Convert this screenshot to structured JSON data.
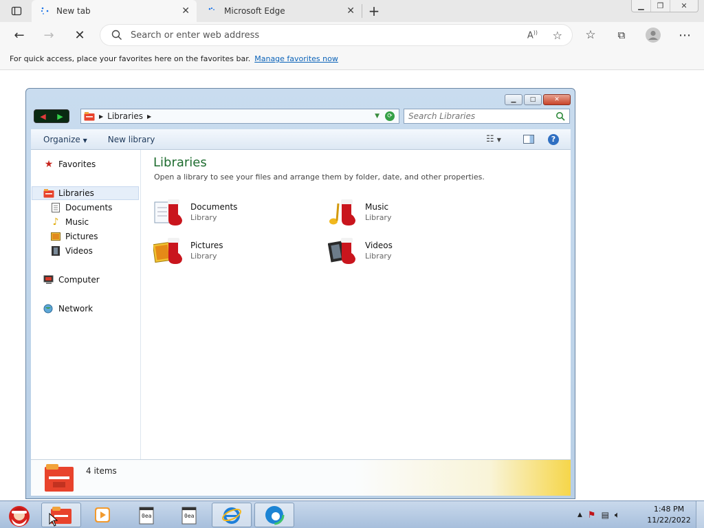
{
  "browser": {
    "tabs": [
      {
        "label": "New tab",
        "active": true
      },
      {
        "label": "Microsoft Edge",
        "active": false
      }
    ],
    "new_tab_icon": "plus-icon",
    "address_placeholder": "Search or enter web address",
    "favbar": {
      "message": "For quick access, place your favorites here on the favorites bar.",
      "link": "Manage favorites now"
    },
    "accent_link": "#0a62b8"
  },
  "explorer": {
    "breadcrumb": "Libraries",
    "search_placeholder": "Search Libraries",
    "commands": {
      "organize": "Organize",
      "new_library": "New library"
    },
    "nav": {
      "favorites": "Favorites",
      "libraries": "Libraries",
      "documents": "Documents",
      "music": "Music",
      "pictures": "Pictures",
      "videos": "Videos",
      "computer": "Computer",
      "network": "Network"
    },
    "title": "Libraries",
    "description": "Open a library to see your files and arrange them by folder, date, and other properties.",
    "libraries": [
      {
        "name": "Documents",
        "type": "Library"
      },
      {
        "name": "Music",
        "type": "Library"
      },
      {
        "name": "Pictures",
        "type": "Library"
      },
      {
        "name": "Videos",
        "type": "Library"
      }
    ],
    "item_count": "4 items",
    "title_color": "#1e6c2f"
  },
  "taskbar": {
    "time": "1:48 PM",
    "date": "11/22/2022"
  }
}
